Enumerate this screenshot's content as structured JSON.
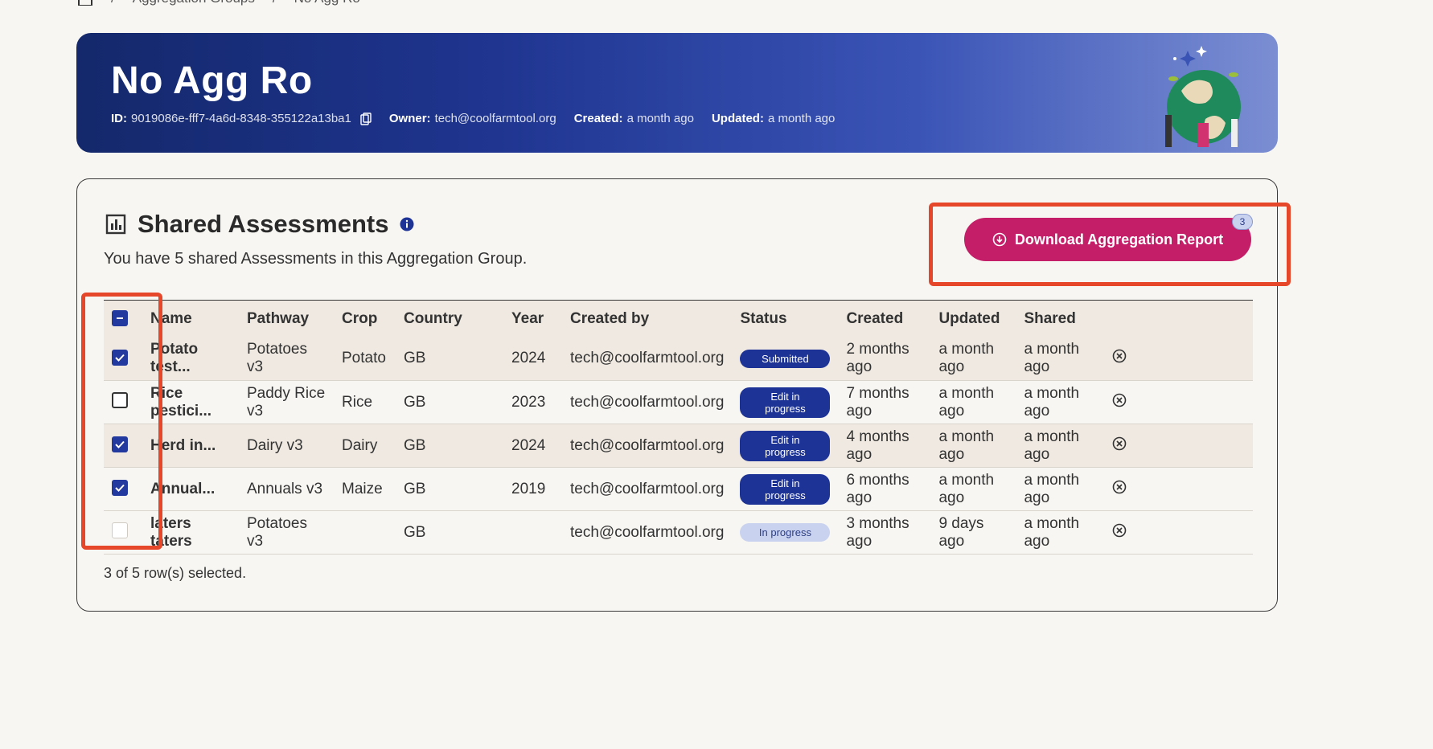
{
  "breadcrumb": {
    "items": [
      "Aggregation Groups",
      "No Agg Ro"
    ]
  },
  "banner": {
    "title": "No Agg Ro",
    "id_label": "ID:",
    "id_value": "9019086e-fff7-4a6d-8348-355122a13ba1",
    "owner_label": "Owner:",
    "owner_value": "tech@coolfarmtool.org",
    "created_label": "Created:",
    "created_value": "a month ago",
    "updated_label": "Updated:",
    "updated_value": "a month ago"
  },
  "card": {
    "title": "Shared Assessments",
    "subtitle": "You have 5 shared Assessments in this Aggregation Group.",
    "download_label": "Download Aggregation Report",
    "download_badge": "3",
    "footer": "3 of 5 row(s) selected."
  },
  "table": {
    "columns": [
      "Name",
      "Pathway",
      "Crop",
      "Country",
      "Year",
      "Created by",
      "Status",
      "Created",
      "Updated",
      "Shared"
    ],
    "rows": [
      {
        "checked": true,
        "name": "Potato test...",
        "pathway": "Potatoes v3",
        "crop": "Potato",
        "country": "GB",
        "year": "2024",
        "created_by": "tech@coolfarmtool.org",
        "status": "Submitted",
        "created": "2 months ago",
        "updated": "a month ago",
        "shared": "a month ago"
      },
      {
        "checked": false,
        "name": "Rice pestici...",
        "pathway": "Paddy Rice v3",
        "crop": "Rice",
        "country": "GB",
        "year": "2023",
        "created_by": "tech@coolfarmtool.org",
        "status": "Edit in progress",
        "created": "7 months ago",
        "updated": "a month ago",
        "shared": "a month ago"
      },
      {
        "checked": true,
        "name": "Herd in...",
        "pathway": "Dairy v3",
        "crop": "Dairy",
        "country": "GB",
        "year": "2024",
        "created_by": "tech@coolfarmtool.org",
        "status": "Edit in progress",
        "created": "4 months ago",
        "updated": "a month ago",
        "shared": "a month ago"
      },
      {
        "checked": true,
        "name": "Annual...",
        "pathway": "Annuals v3",
        "crop": "Maize",
        "country": "GB",
        "year": "2019",
        "created_by": "tech@coolfarmtool.org",
        "status": "Edit in progress",
        "created": "6 months ago",
        "updated": "a month ago",
        "shared": "a month ago"
      },
      {
        "checked": false,
        "name": "laters taters",
        "pathway": "Potatoes v3",
        "crop": "",
        "country": "GB",
        "year": "",
        "created_by": "tech@coolfarmtool.org",
        "status": "In progress",
        "created": "3 months ago",
        "updated": "9 days ago",
        "shared": "a month ago"
      }
    ]
  },
  "colors": {
    "primary": "#1e3396",
    "accent": "#c41e68",
    "highlight": "#e6472a"
  },
  "icons": [
    "home-icon",
    "copy-icon",
    "chart-icon",
    "info-icon",
    "download-icon",
    "remove-icon",
    "check-icon",
    "minus-icon"
  ]
}
